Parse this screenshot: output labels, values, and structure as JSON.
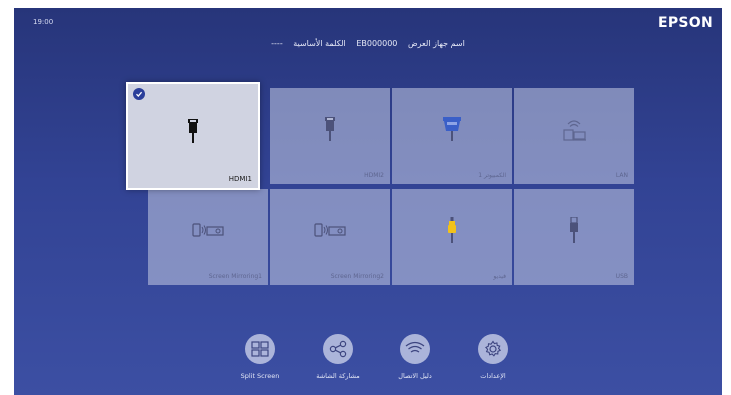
{
  "status": {
    "time": "19:00"
  },
  "brand": {
    "logo_text": "EPSON"
  },
  "header": {
    "device_name_label": "اسم جهاز العرض",
    "device_name_value": "EB000000",
    "keyword_label": "الكلمة الأساسية",
    "keyword_value": "----"
  },
  "sources": [
    {
      "label": "HDMI1",
      "icon": "hdmi-icon",
      "selected": true
    },
    {
      "label": "HDMI2",
      "icon": "hdmi-icon",
      "selected": false
    },
    {
      "label": "الكمبيوتر 1",
      "icon": "vga-icon",
      "selected": false
    },
    {
      "label": "LAN",
      "icon": "lan-icon",
      "selected": false
    },
    {
      "label": "Screen Mirroring1",
      "icon": "screen-mirroring-icon",
      "selected": false
    },
    {
      "label": "Screen Mirroring2",
      "icon": "screen-mirroring-icon",
      "selected": false
    },
    {
      "label": "فيديو",
      "icon": "video-icon",
      "selected": false
    },
    {
      "label": "USB",
      "icon": "usb-icon",
      "selected": false
    }
  ],
  "bottom_menu": [
    {
      "label": "Split Screen",
      "icon": "split-screen-icon"
    },
    {
      "label": "مشاركة الشاشة",
      "icon": "share-icon"
    },
    {
      "label": "دليل الاتصال",
      "icon": "wifi-icon"
    },
    {
      "label": "الإعدادات",
      "icon": "gear-icon"
    }
  ],
  "colors": {
    "background_top": "#27357a",
    "background_bottom": "#3c4fa3",
    "tile": "#bec5e0",
    "selected_tile": "#d0d3e1",
    "check_badge": "#2b3f9a",
    "vga_blue": "#3a5fc8",
    "video_yellow": "#f2c21a"
  }
}
